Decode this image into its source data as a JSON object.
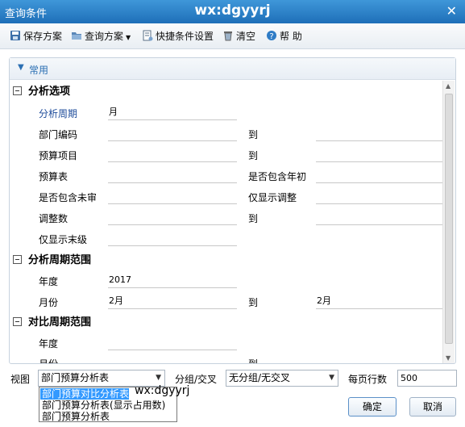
{
  "window": {
    "title": "查询条件",
    "watermark": "wx:dgyyrj",
    "close_glyph": "✕"
  },
  "toolbar": {
    "save_label": "保存方案",
    "query_label": "查询方案",
    "quick_label": "快捷条件设置",
    "clear_label": "清空",
    "help_label": "帮 助"
  },
  "group": {
    "label": "常用",
    "arrow": "▼"
  },
  "sections": {
    "analysis": "分析选项",
    "period_range": "分析周期范围",
    "compare_range": "对比周期范围"
  },
  "fields": {
    "analysis_period_label": "分析周期",
    "analysis_period_value": "月",
    "dept_code_label": "部门编码",
    "to1": "到",
    "budget_item_label": "预算项目",
    "to2": "到",
    "budget_table_label": "预算表",
    "include_initial_label": "是否包含年初",
    "include_unreviewed_label": "是否包含未审",
    "only_adjust_label": "仅显示调整",
    "adjust_count_label": "调整数",
    "to3": "到",
    "only_last_level_label": "仅显示末级",
    "year_label": "年度",
    "year_value": "2017",
    "month_label": "月份",
    "month_from_value": "2月",
    "to4": "到",
    "month_to_value": "2月",
    "cmp_year_label": "年度",
    "cmp_month_label": "月份",
    "to5": "到"
  },
  "bottom": {
    "view_label": "视图",
    "view_value": "部门预算分析表",
    "group_label": "分组/交叉",
    "group_value": "无分组/无交叉",
    "rows_label": "每页行数",
    "rows_value": "500"
  },
  "dropdown": {
    "options": [
      "部门预算对比分析表",
      "部门预算分析表(显示占用数)",
      "部门预算分析表"
    ],
    "watermark": "wx:dgyyrj"
  },
  "buttons": {
    "ok": "确定",
    "cancel": "取消"
  },
  "colors": {
    "titlebar": "#2a7fc8",
    "accent": "#2b6fb3",
    "selection": "#3399ff"
  }
}
